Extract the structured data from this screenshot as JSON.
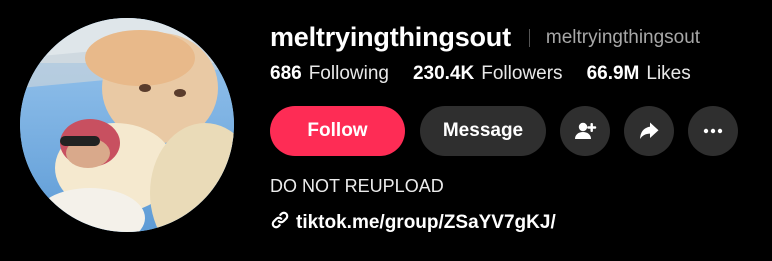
{
  "profile": {
    "username": "meltryingthingsout",
    "nickname": "meltryingthingsout",
    "bio": "DO NOT REUPLOAD",
    "link": "tiktok.me/group/ZSaYV7gKJ/"
  },
  "stats": [
    {
      "value": "686",
      "label": "Following"
    },
    {
      "value": "230.4K",
      "label": "Followers"
    },
    {
      "value": "66.9M",
      "label": "Likes"
    }
  ],
  "actions": {
    "follow_label": "Follow",
    "message_label": "Message",
    "icons": [
      "add-friend-icon",
      "share-icon",
      "more-icon"
    ]
  },
  "colors": {
    "accent": "#fe2c55",
    "button_bg": "#2f2f2f",
    "background": "#000000",
    "secondary_text": "#a8a8a8"
  }
}
